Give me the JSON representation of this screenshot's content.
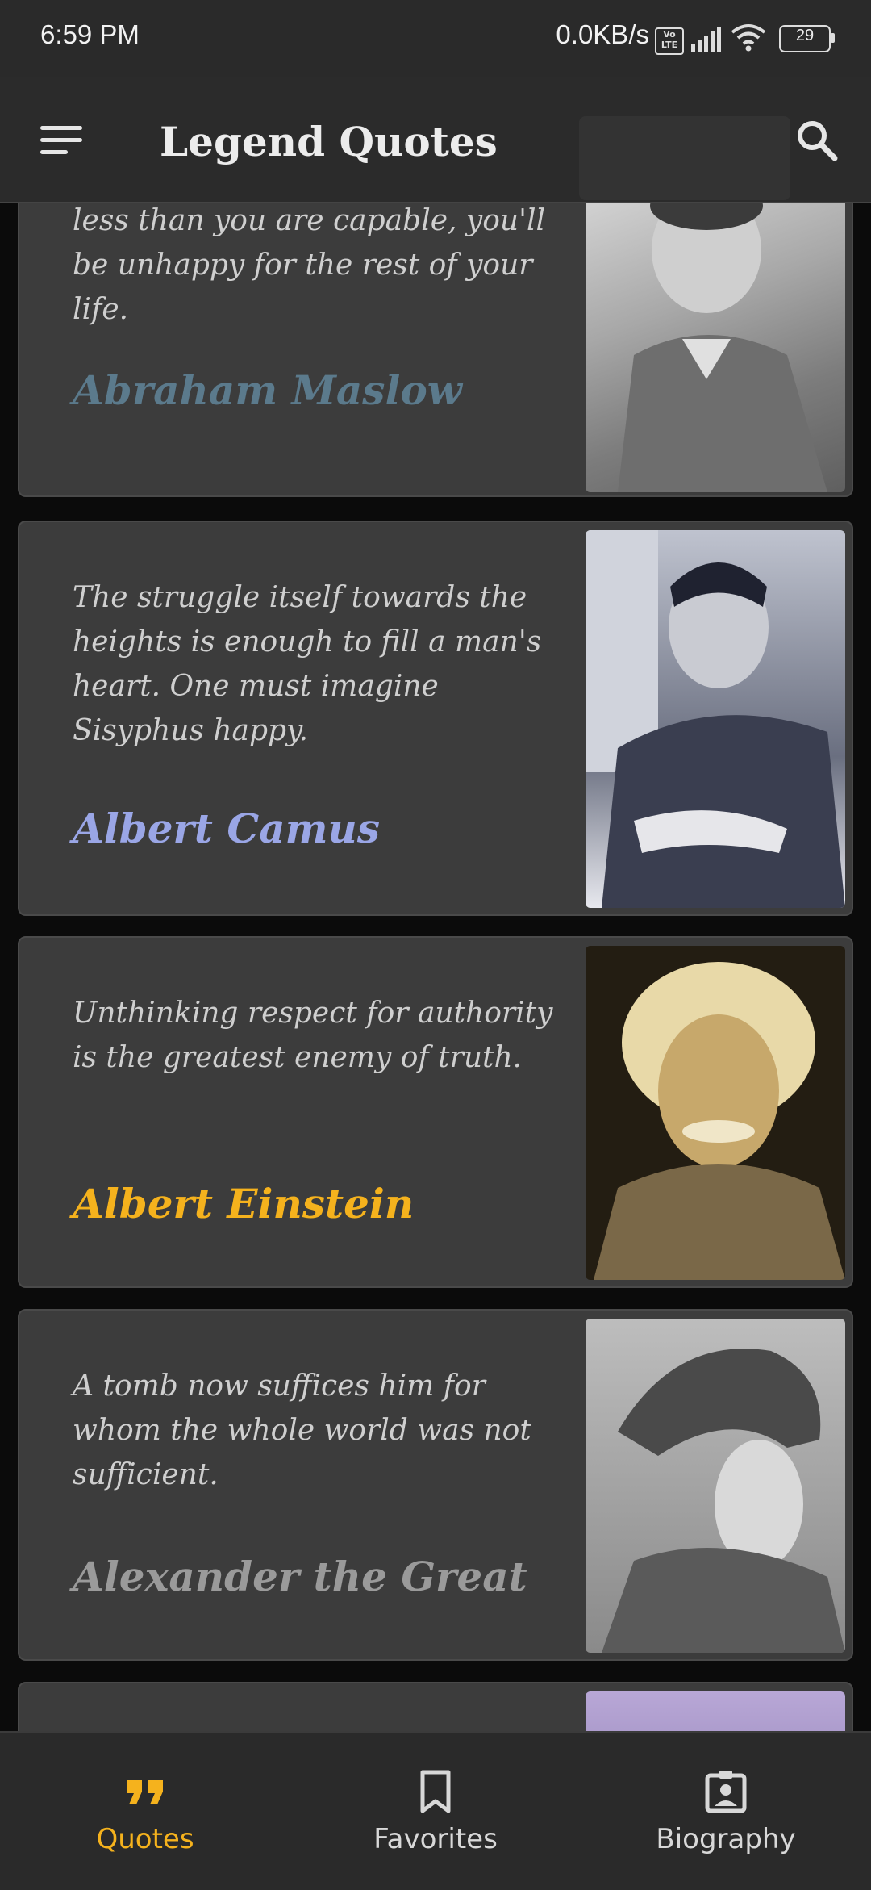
{
  "status_bar": {
    "time": "6:59 PM",
    "network_speed": "0.0KB/s",
    "volte_badge": "Vo LTE",
    "battery": "29"
  },
  "app_bar": {
    "title": "Legend Quotes"
  },
  "quotes": [
    {
      "text": "less than you are capable, you'll be unhappy for the rest of your life.",
      "author": "Abraham Maslow",
      "author_color": "#5b7a8c"
    },
    {
      "text": "The struggle itself towards the heights is enough to fill a man's heart. One must imagine Sisyphus happy.",
      "author": "Albert Camus",
      "author_color": "#9aa6e6"
    },
    {
      "text": "Unthinking respect for authority is the greatest enemy of truth.",
      "author": "Albert Einstein",
      "author_color": "#f5b21d"
    },
    {
      "text": "A tomb now suffices him for whom the whole world was not sufficient.",
      "author": "Alexander the Great",
      "author_color": "#9a9a9a"
    }
  ],
  "bottom_nav": {
    "items": [
      {
        "label": "Quotes",
        "icon": "quote-icon",
        "active": true
      },
      {
        "label": "Favorites",
        "icon": "bookmark-icon",
        "active": false
      },
      {
        "label": "Biography",
        "icon": "badge-icon",
        "active": false
      }
    ],
    "active_color": "#f5b21d",
    "inactive_color": "#d8d8d8"
  }
}
